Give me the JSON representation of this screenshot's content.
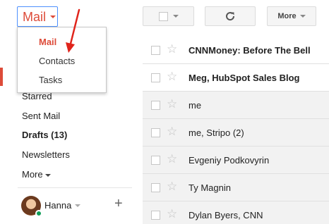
{
  "app_switcher": {
    "label": "Mail"
  },
  "app_menu": {
    "items": [
      {
        "label": "Mail",
        "active": true
      },
      {
        "label": "Contacts",
        "active": false
      },
      {
        "label": "Tasks",
        "active": false
      }
    ]
  },
  "toolbar": {
    "more_label": "More"
  },
  "sidebar": {
    "items": [
      {
        "label": "Starred"
      },
      {
        "label": "Sent Mail"
      },
      {
        "label": "Drafts (13)"
      },
      {
        "label": "Newsletters"
      },
      {
        "label": "More"
      }
    ]
  },
  "user": {
    "name": "Hanna"
  },
  "emails": [
    {
      "sender": "CNNMoney: Before The Bell",
      "unread": true
    },
    {
      "sender": "Meg, HubSpot Sales Blog",
      "unread": true
    },
    {
      "sender": "me",
      "unread": false
    },
    {
      "sender": "me, Stripo (2)",
      "unread": false
    },
    {
      "sender": "Evgeniy Podkovyrin",
      "unread": false
    },
    {
      "sender": "Ty Magnin",
      "unread": false
    },
    {
      "sender": "Dylan Byers, CNN",
      "unread": false
    }
  ],
  "colors": {
    "accent_red": "#dd4b39",
    "focus_blue": "#4d90fe",
    "online_green": "#0f9d58"
  }
}
